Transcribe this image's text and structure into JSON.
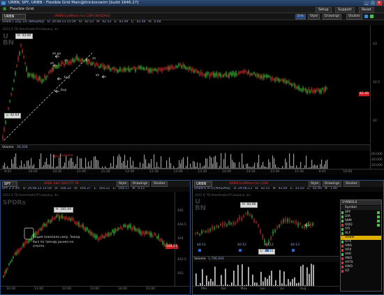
{
  "window": {
    "title": "URBN, SPY, URBN - Flexible Grid Main@thinkorswim [build 1846.27]"
  },
  "menubar": {
    "title": "Flexible Grid",
    "buttons": [
      "Setup",
      "Support",
      "Reset"
    ]
  },
  "main_chart": {
    "symbol": "URBN",
    "description": "URBN Outfitters Inc COM [NASDAQ]",
    "timeframe": "3 m",
    "chips": [
      "Style",
      "Drawings",
      "Studies"
    ],
    "info": {
      "desc": "URBN 1 Day 1m [NASDAQ]",
      "date": "D: 29.08.13 15:59",
      "o_label": "O:",
      "o": "42.53",
      "h_label": "H:",
      "h": "42.53",
      "l_label": "L:",
      "l": "42.49",
      "c_label": "C:",
      "c": "42.49",
      "r_label": "R:",
      "r": "0.04"
    },
    "copyright": "2013 © TD Ameritrade IP Company, Inc.",
    "high_label": "H: 43.00",
    "low_label": "L: 42.03",
    "last_price": "42.49",
    "annotations": [
      "sh.gx",
      "sh",
      "sh",
      "sh",
      "buy",
      "buy",
      "sh"
    ],
    "price_axis": [
      "43",
      "42.5",
      "42"
    ],
    "time_axis": [
      "9:45",
      "10:00",
      "10:30",
      "11:00",
      "11:30",
      "12:00",
      "12:30",
      "13:00",
      "13:30",
      "14:00",
      "14:30",
      "15:00",
      "15:30",
      "9:45",
      "10:00"
    ],
    "volume_label": "Volume",
    "volume_value": "26,504",
    "volume_note": "volume",
    "volume_axis": [
      "60,000",
      "40,000",
      "20,000"
    ]
  },
  "spy_chart": {
    "symbol": "SPY",
    "description": "SPDR S&P 500 ETF TR",
    "chips": [
      "Style",
      "Drawings",
      "Studies"
    ],
    "info": {
      "desc": "SPY 2 d 3m",
      "date": "D: 29.08.13 15:59",
      "o_label": "O:",
      "o": "164.22",
      "h_label": "H:",
      "h": "164.27",
      "l_label": "L:",
      "l": "164.12",
      "c_label": "C:",
      "c": "164.17",
      "r_label": "R:",
      "r": "0.15"
    },
    "copyright": "2013 © TD Ameritrade IP Company, Inc.",
    "high_label": "H: 165.04",
    "last_price": "164.17",
    "note": "Акция показала силу. Заход был по тренду рынка на откате.",
    "price_axis": [
      "165",
      "164.5",
      "164",
      "163.5",
      "163"
    ],
    "time_axis": [
      "10:30",
      "11:00",
      "12:00",
      "13:00",
      "14:00",
      "15:00"
    ]
  },
  "urbn_daily": {
    "symbol": "URBN",
    "description": "URBN Outfitters Inc COM",
    "chips": [
      "Style",
      "Drawings",
      "Studies"
    ],
    "info": {
      "desc": "URBN 6 m D [NASDAQ]",
      "date": "D: 29.08.13",
      "o_label": "O:",
      "o": "42.15",
      "h_label": "H:",
      "h": "43.00",
      "l_label": "L:",
      "l": "42.03",
      "c_label": "C:",
      "c": "42.49",
      "r_label": "R:",
      "r": "1.00"
    },
    "copyright": "2013 © TD Ameritrade IP Company, Inc.",
    "high_label": "H: 44.08",
    "low_label": "L: 36.11",
    "dividend_labels": [
      "$0.11",
      "$0.12",
      "$0.12",
      "$0.13"
    ],
    "volume_label": "Volume",
    "volume_value": "1,796,644",
    "time_axis": [
      "Mar",
      "Apr",
      "May",
      "Jun",
      "Jul",
      "Aug"
    ]
  },
  "watchlist": {
    "title": "SYMBOLS",
    "header": "Symbol",
    "symbols": [
      "SPY",
      "DIA",
      "IWM",
      "QQQ",
      "IYR",
      "XLF",
      "URBN",
      "UTX",
      "UNG",
      "VRX",
      "VAR",
      "VNQ",
      "VRTX",
      "VWO",
      "VZ"
    ],
    "dot_colors": [
      "#4cc24c",
      "#4cc24c",
      "#4cc24c",
      "#e03030",
      "#4cc24c",
      "#4cc24c",
      "#e0a000",
      "#4cc24c",
      "#e03030",
      "#e03030",
      "#4cc24c",
      "#e03030",
      "#e03030",
      "#e03030",
      "#e03030"
    ],
    "selected_index": 6
  }
}
